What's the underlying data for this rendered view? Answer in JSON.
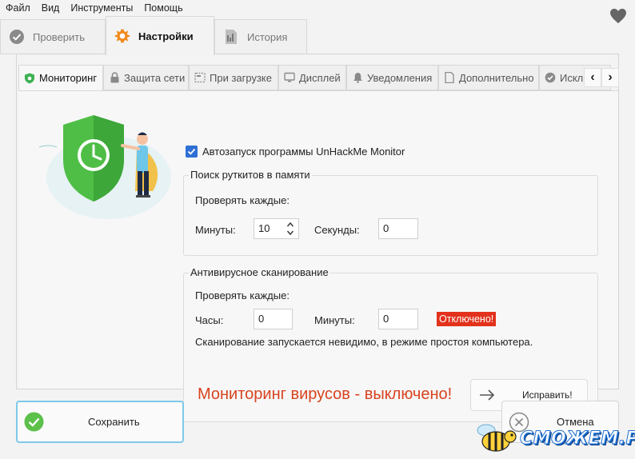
{
  "menu": [
    "Файл",
    "Вид",
    "Инструменты",
    "Помощь"
  ],
  "top_tabs": [
    {
      "label": "Проверить",
      "icon": "check-circle-icon",
      "active": false
    },
    {
      "label": "Настройки",
      "icon": "gear-icon",
      "active": true
    },
    {
      "label": "История",
      "icon": "history-icon",
      "active": false
    }
  ],
  "sub_tabs": [
    {
      "label": "Мониторинг",
      "icon": "shield-icon",
      "active": true
    },
    {
      "label": "Защита сети",
      "icon": "lock-icon",
      "active": false
    },
    {
      "label": "При загрузке",
      "icon": "startup-icon",
      "active": false
    },
    {
      "label": "Дисплей",
      "icon": "monitor-icon",
      "active": false
    },
    {
      "label": "Уведомления",
      "icon": "bell-icon",
      "active": false
    },
    {
      "label": "Дополнительно",
      "icon": "document-icon",
      "active": false
    },
    {
      "label": "Искл",
      "icon": "check-circle-icon",
      "active": false
    }
  ],
  "scroll": {
    "left": "‹",
    "right": "›"
  },
  "monitoring": {
    "autorun_label": "Автозапуск программы UnHackMe Monitor",
    "autorun_checked": true,
    "rootkit_group": {
      "title": "Поиск руткитов в памяти",
      "check_every": "Проверять каждые:",
      "minutes_label": "Минуты:",
      "minutes_value": "10",
      "seconds_label": "Секунды:",
      "seconds_value": "0"
    },
    "antivirus_group": {
      "title": "Антивирусное сканирование",
      "check_every": "Проверять каждые:",
      "hours_label": "Часы:",
      "hours_value": "0",
      "minutes_label": "Минуты:",
      "minutes_value": "0",
      "status_badge": "Отключено!",
      "note": "Сканирование запускается невидимо, в режиме простоя компьютера.",
      "warning": "Мониторинг вирусов - выключено!",
      "fix_button": "Исправить!"
    }
  },
  "buttons": {
    "save": "Сохранить",
    "cancel": "Отмена"
  },
  "watermark": "СМОЖЕМ.РУ",
  "colors": {
    "accent_blue": "#2f6fd6",
    "shield_green": "#5cc04a",
    "alert_red": "#e2321c",
    "warning_text": "#d8431f",
    "save_border": "#7ec8ea"
  }
}
